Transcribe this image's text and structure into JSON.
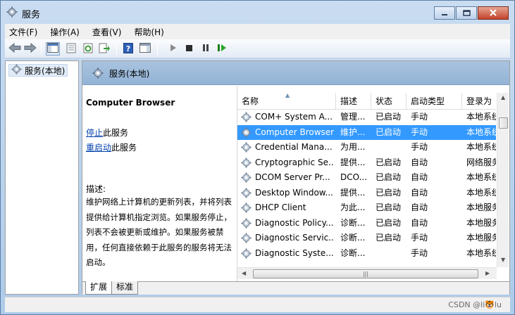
{
  "window": {
    "title": "服务"
  },
  "menu": [
    "文件(F)",
    "操作(A)",
    "查看(V)",
    "帮助(H)"
  ],
  "toolbar_icons": [
    "back-arrow-icon",
    "forward-arrow-icon",
    "show-hide-tree-icon",
    "properties-icon",
    "refresh-icon",
    "export-list-icon",
    "help-icon",
    "show-hide-action-pane-icon",
    "start-service-icon",
    "stop-service-icon",
    "pause-service-icon",
    "restart-service-icon"
  ],
  "tree": {
    "node_label": "服务(本地)"
  },
  "main": {
    "header_label": "服务(本地)",
    "selected_service_title": "Computer Browser",
    "actions": [
      {
        "link": "停止",
        "suffix": "此服务"
      },
      {
        "link": "重启动",
        "suffix": "此服务"
      }
    ],
    "description_label": "描述:",
    "description_text": "维护网络上计算机的更新列表，并将列表提供给计算机指定浏览。如果服务停止，列表不会被更新或维护。如果服务被禁用，任何直接依赖于此服务的服务将无法启动。"
  },
  "list": {
    "columns": [
      "名称",
      "描述",
      "状态",
      "启动类型",
      "登录为"
    ],
    "rows": [
      [
        "COM+ System A...",
        "管理...",
        "已启动",
        "手动",
        "本地系统"
      ],
      [
        "Computer Browser",
        "维护...",
        "已启动",
        "手动",
        "本地系统"
      ],
      [
        "Credential Mana...",
        "为用...",
        "",
        "手动",
        "本地系统"
      ],
      [
        "Cryptographic Se...",
        "提供...",
        "已启动",
        "自动",
        "网络服务"
      ],
      [
        "DCOM Server Pr...",
        "DCO...",
        "已启动",
        "自动",
        "本地系统"
      ],
      [
        "Desktop Window...",
        "提供...",
        "已启动",
        "自动",
        "本地系统"
      ],
      [
        "DHCP Client",
        "为此...",
        "已启动",
        "自动",
        "本地服务"
      ],
      [
        "Diagnostic Policy...",
        "诊断...",
        "已启动",
        "自动",
        "本地服务"
      ],
      [
        "Diagnostic Servic...",
        "诊断...",
        "已启动",
        "手动",
        "本地服务"
      ],
      [
        "Diagnostic Syste...",
        "诊断...",
        "",
        "手动",
        "本地系统"
      ]
    ],
    "selected_index": 1
  },
  "tabs": [
    "扩展",
    "标准"
  ],
  "active_tab": 0,
  "watermark": "CSDN @li🐯lu",
  "colors": {
    "selection": "#3399ff",
    "link": "#0645ad",
    "header": "#a9c3df"
  }
}
